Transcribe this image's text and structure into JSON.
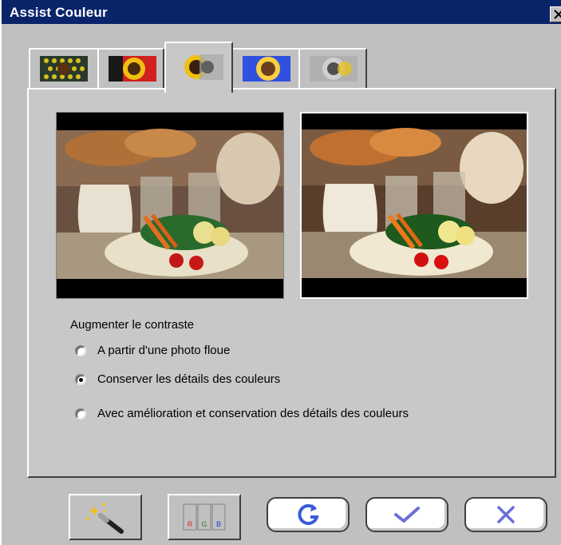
{
  "window": {
    "title": "Assist Couleur"
  },
  "tabs": [
    {
      "icon": "sunflower-yellow-mesh-icon"
    },
    {
      "icon": "sunflower-dark-icon"
    },
    {
      "icon": "sunflower-contrast-icon",
      "active": true
    },
    {
      "icon": "sunflower-bright-icon"
    },
    {
      "icon": "sunflower-gray-icon"
    }
  ],
  "preview": {
    "before_icon": "photo-before-still-life",
    "after_icon": "photo-after-still-life"
  },
  "contrast": {
    "label": "Augmenter le contraste",
    "options": [
      {
        "label": "A partir d'une photo floue",
        "selected": false
      },
      {
        "label": "Conserver les détails des couleurs",
        "selected": true
      },
      {
        "label": "Avec amélioration et conservation des détails des couleurs",
        "selected": false
      }
    ]
  },
  "buttons": {
    "magic": "magic-wand-icon",
    "rgb": "rgb-channels-icon",
    "rgb_letters": [
      "R",
      "G",
      "B"
    ],
    "reset": "reset-icon",
    "ok": "checkmark-icon",
    "cancel": "x-icon"
  },
  "colors": {
    "title_bar": "#0a246a",
    "accent_blue": "#3b5bd6"
  }
}
